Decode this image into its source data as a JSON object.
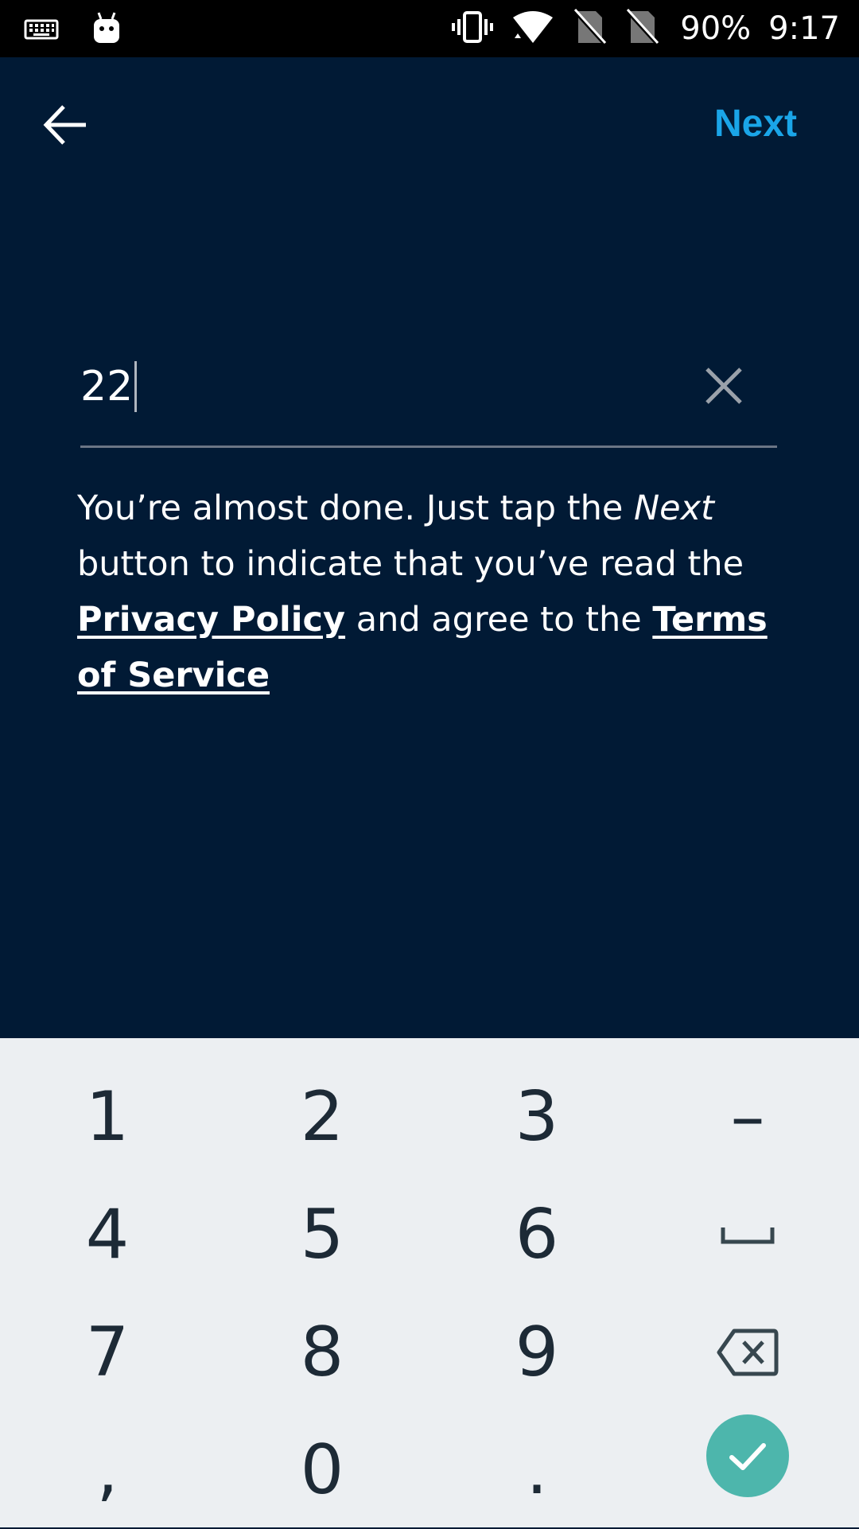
{
  "status_bar": {
    "battery": "90%",
    "time": "9:17",
    "icons": [
      "keyboard-icon",
      "android-icon",
      "vibrate-icon",
      "wifi-icon",
      "no-sim-icon",
      "no-sim-icon"
    ]
  },
  "toolbar": {
    "back_icon": "arrow-left-icon",
    "next_label": "Next"
  },
  "input": {
    "value": "22",
    "clear_icon": "close-icon"
  },
  "message": {
    "part1": "You’re almost done. Just tap the ",
    "next_word": "Next",
    "part2": " button to indicate that you’ve read the ",
    "privacy_link": "Privacy Policy",
    "part3": " and agree to the ",
    "terms_link": "Terms of Service"
  },
  "keyboard": {
    "keys": [
      [
        "1",
        "2",
        "3",
        "–"
      ],
      [
        "4",
        "5",
        "6",
        "space"
      ],
      [
        "7",
        "8",
        "9",
        "backspace"
      ],
      [
        ",",
        "0",
        ".",
        "done"
      ]
    ],
    "done_color": "#4db6ac"
  },
  "colors": {
    "background": "#011a35",
    "accent": "#1aa5e8",
    "keyboard_bg": "#eceff2"
  }
}
